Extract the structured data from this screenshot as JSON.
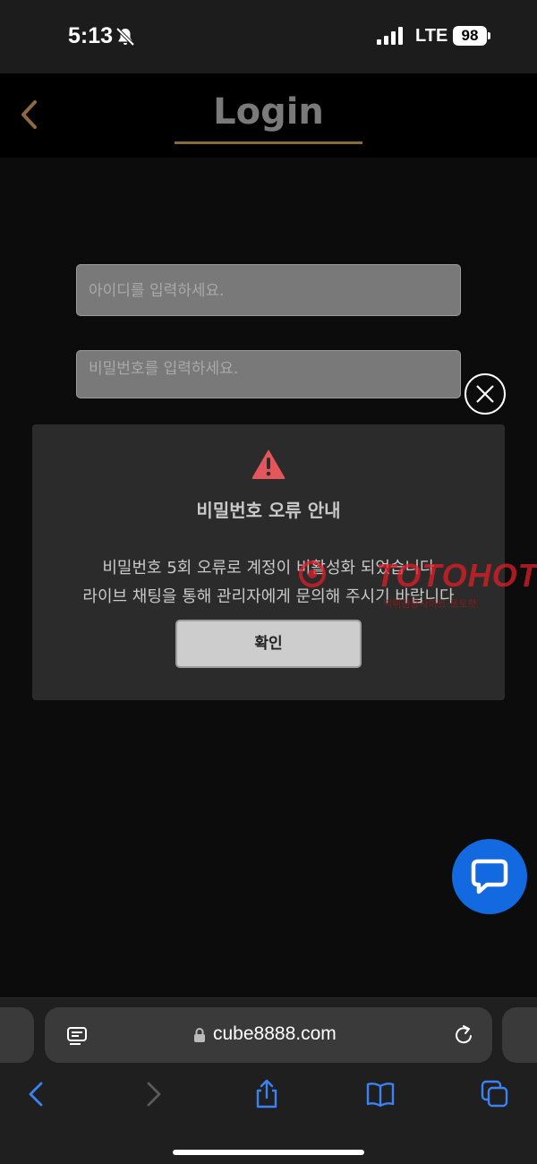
{
  "status_bar": {
    "time": "5:13",
    "network": "LTE",
    "battery": "98",
    "icons": [
      "bell-slash-icon",
      "signal-icon"
    ]
  },
  "header": {
    "title": "Login",
    "accent_color": "#8a6a3e",
    "back_icon": "chevron-left-icon"
  },
  "form": {
    "id_placeholder": "아이디를 입력하세요.",
    "pw_placeholder": "비밀번호를 입력하세요."
  },
  "modal": {
    "icon": "warning-triangle-icon",
    "icon_color": "#e3565c",
    "title": "비밀번호 오류 안내",
    "line1": "비밀번호 5회 오류로 계정이 비활성화 되었습니다",
    "line2": "라이브 채팅을 통해 관리자에게 문의해 주시기 바랍니다",
    "confirm_label": "확인",
    "close_icon": "close-circle-icon"
  },
  "watermark": {
    "text": "TOTOHOT",
    "subtext": "먹튀검증사이트 토토핫",
    "color": "#e61e28"
  },
  "chat": {
    "icon": "chat-bubble-icon",
    "color": "#1369e0"
  },
  "browser": {
    "url": "cube8888.com",
    "icons": [
      "reader-icon",
      "lock-icon",
      "reload-icon",
      "back-arrow-icon",
      "forward-arrow-icon",
      "share-icon",
      "bookmarks-icon",
      "tabs-icon"
    ]
  }
}
